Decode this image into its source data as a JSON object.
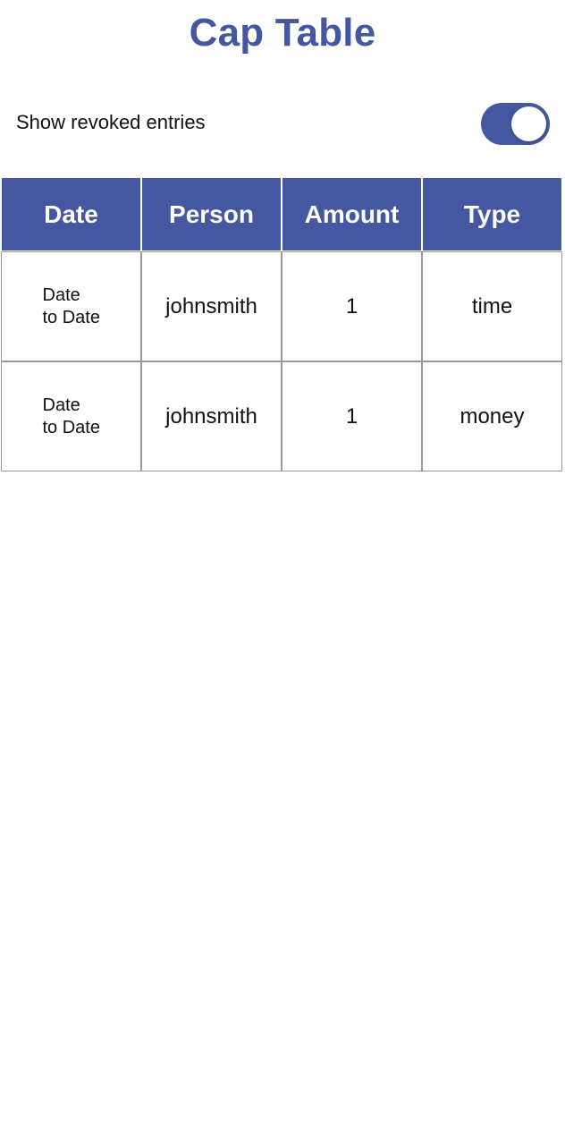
{
  "header": {
    "title": "Cap Table"
  },
  "filter": {
    "label": "Show revoked entries",
    "toggle_on": true
  },
  "table": {
    "columns": [
      "Date",
      "Person",
      "Amount",
      "Type"
    ],
    "rows": [
      {
        "date_start": "Date",
        "date_end": "to Date",
        "person": "johnsmith",
        "amount": "1",
        "type": "time"
      },
      {
        "date_start": "Date",
        "date_end": "to Date",
        "person": "johnsmith",
        "amount": "1",
        "type": "money"
      }
    ]
  },
  "colors": {
    "accent": "#4457a0",
    "border": "#9a9a9a"
  }
}
